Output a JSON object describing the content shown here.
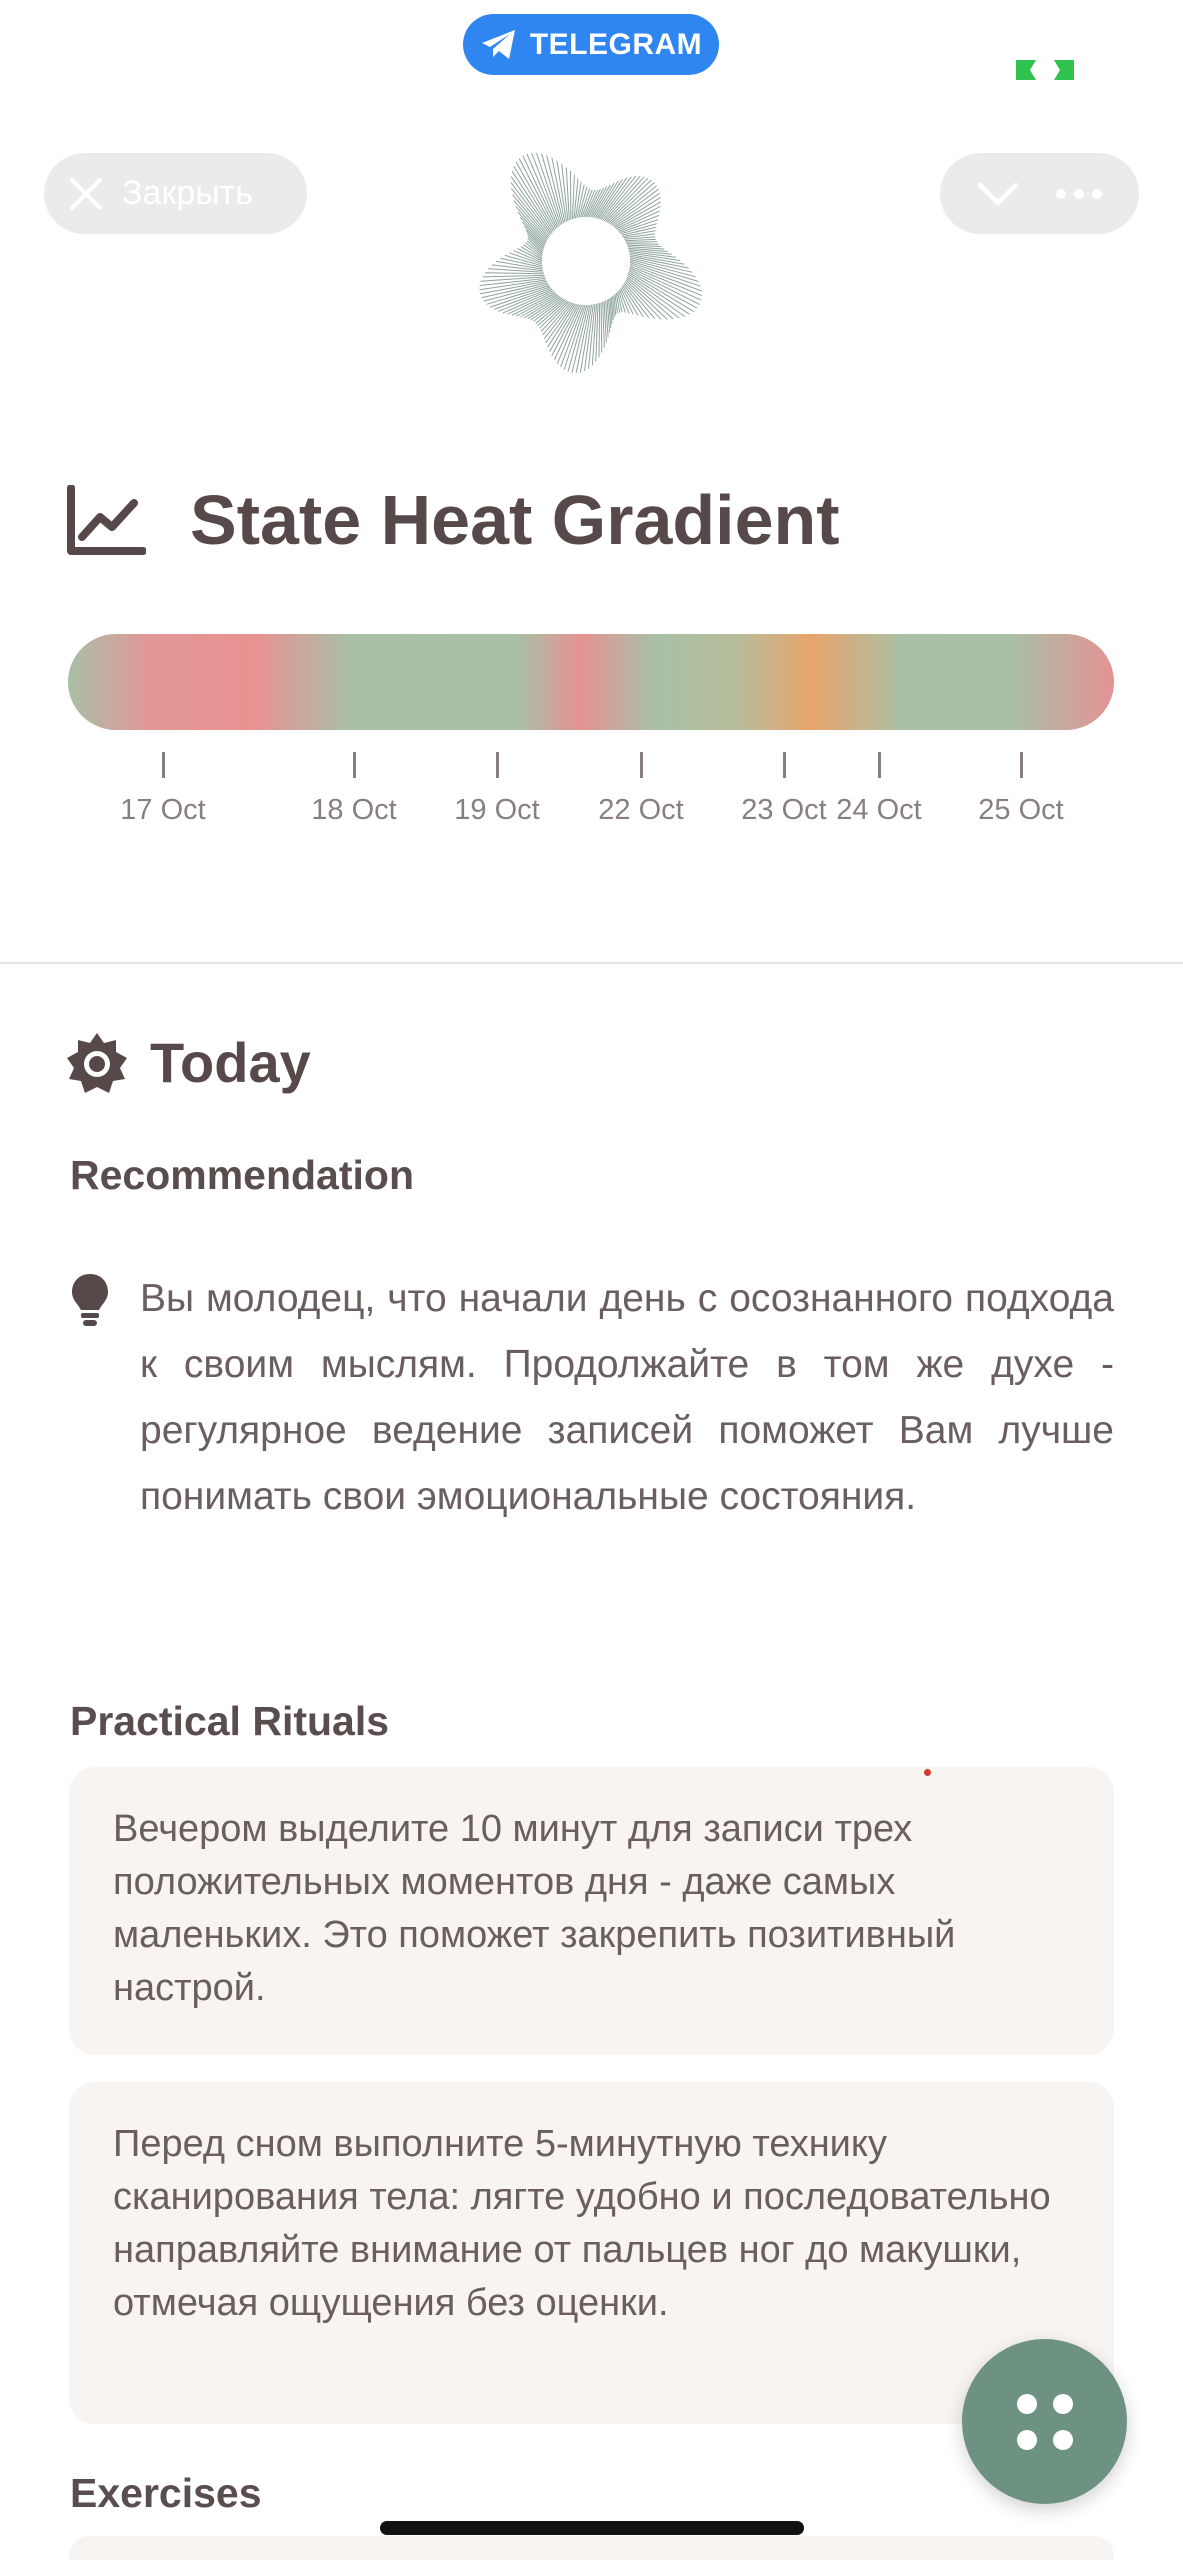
{
  "system": {
    "telegram_label": "TELEGRAM"
  },
  "topbar": {
    "close_label": "Закрыть"
  },
  "icons": {
    "telegram": "paper-plane-icon",
    "close": "x-icon",
    "chevron": "chevron-down-icon",
    "more": "more-dots-icon",
    "logo": "radial-burst-logo",
    "chart": "line-chart-icon",
    "today": "sun-icon",
    "recommendation": "lightbulb-icon",
    "fab": "grid-dots-icon"
  },
  "state": {
    "title": "State Heat Gradient",
    "dates": [
      "17 Oct",
      "18 Oct",
      "19 Oct",
      "22 Oct",
      "23 Oct",
      "24 Oct",
      "25 Oct"
    ]
  },
  "today": {
    "title": "Today",
    "recommendation_title": "Recommendation",
    "recommendation_text": "Вы молодец, что начали день с осознанного подхода к своим мыслям. Продолжайте в том же духе - регулярное ведение записей поможет Вам лучше понимать свои эмоциональные состояния.",
    "rituals_title": "Practical Rituals",
    "rituals": [
      "Вечером выделите 10 минут для записи трех положительных моментов дня - даже самых маленьких. Это поможет закрепить позитивный настрой.",
      "Перед сном выполните 5-минутную технику сканирования тела: лягте удобно и последовательно направляйте внимание от пальцев ног до макушки, отмечая ощущения без оценки."
    ],
    "exercises_title": "Exercises"
  },
  "colors": {
    "telegram_blue": "#2f86f0",
    "state_green": "#a9c0a6",
    "state_red": "#e59292",
    "state_orange": "#e8a46d",
    "fab_green": "#6e9282",
    "card_bg": "#f8f4f2",
    "text": "#574949"
  }
}
